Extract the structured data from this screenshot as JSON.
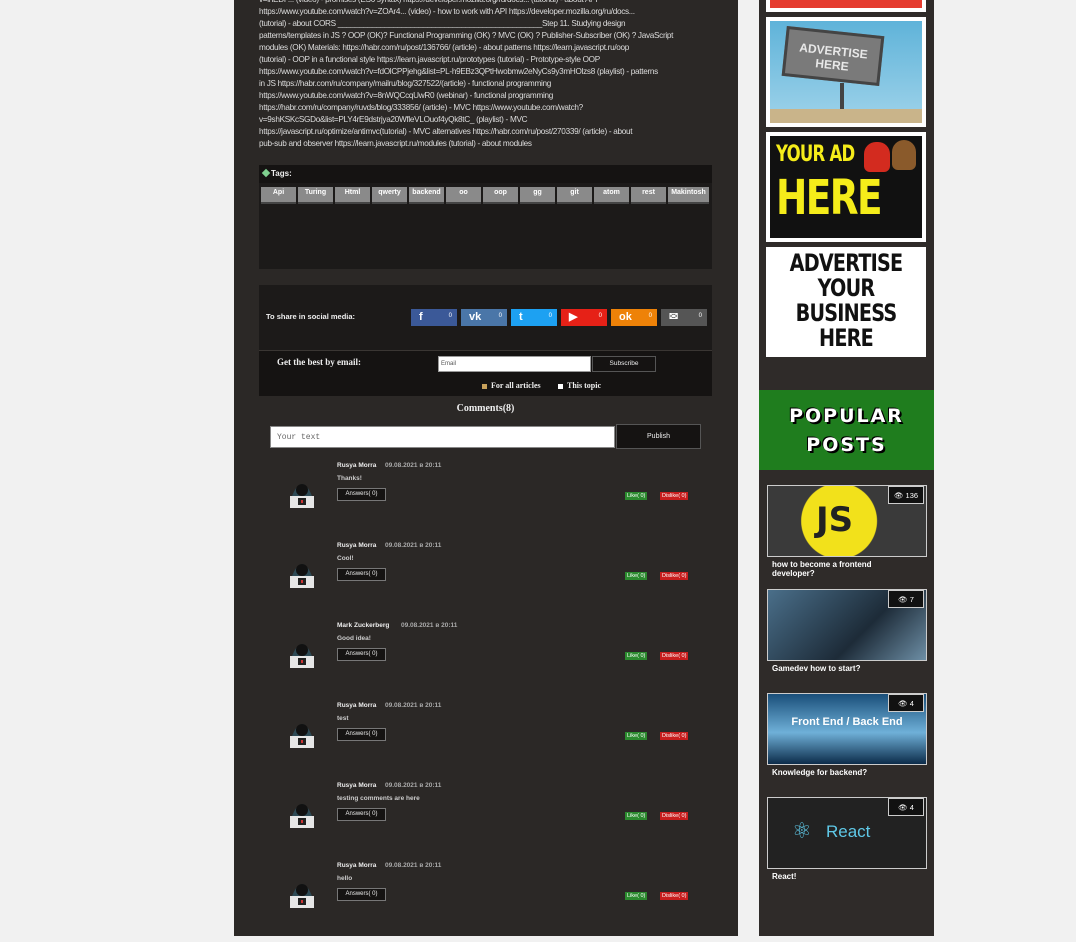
{
  "article": {
    "lines": [
      "v=lnEDP... (video) - promises (ES6 syntax) https://developer.mozilla.org/ru/docs... (tutorial) - about API",
      "https://www.youtube.com/watch?v=ZOAr4... (video) - how to work with API https://developer.mozilla.org/ru/docs...",
      "(tutorial) - about CORS ________________________________________________Step 11. Studying design",
      "patterns/templates in JS ? OOP (OK)? Functional Programming (OK) ? MVC (OK) ? Publisher-Subscriber (OK) ? JavaScript",
      "modules (OK) Materials: https://habr.com/ru/post/136766/ (article) - about patterns https://learn.javascript.ru/oop",
      "(tutorial) - OOP in a functional style https://learn.javascript.ru/prototypes (tutorial) - Prototype-style OOP",
      "https://www.youtube.com/watch?v=fdOlCPPjehg&list=PL-h9EBz3QPtHwobmw2eNyCs9y3mHOlzs8 (playlist) - patterns",
      "in JS https://habr.com/ru/company/mailru/blog/327522/(article) - functional programming",
      "https://www.youtube.com/watch?v=8nWQCcqUwR0 (webinar) - functional programming",
      "https://habr.com/ru/company/ruvds/blog/333856/ (article) - MVC https://www.youtube.com/watch?",
      "v=9shKSKcSGDo&list=PLY4rE9dstrjya20WfleVLOuof4yQk8tC_ (playlist) - MVC",
      "https://javascript.ru/optimize/antimvc(tutorial) - MVC alternatives https://habr.com/ru/post/270339/ (article) - about",
      "pub-sub and observer https://learn.javascript.ru/modules (tutorial) - about modules"
    ]
  },
  "tags": {
    "label": "Tags:",
    "items": [
      "Api",
      "Turing",
      "Html",
      "qwerty",
      "backend",
      "oo",
      "oop",
      "gg",
      "git",
      "atom",
      "rest",
      "Makintosh"
    ]
  },
  "share": {
    "label": "To share in social media:",
    "buttons": [
      {
        "name": "facebook",
        "icon": "f",
        "count": "0",
        "color": "#3b5998"
      },
      {
        "name": "vk",
        "icon": "vk",
        "count": "0",
        "color": "#4a76a8"
      },
      {
        "name": "twitter",
        "icon": "t",
        "count": "0",
        "color": "#1da1f2"
      },
      {
        "name": "youtube",
        "icon": "▶",
        "count": "0",
        "color": "#e62117"
      },
      {
        "name": "odnoklassniki",
        "icon": "ok",
        "count": "0",
        "color": "#ee8208"
      },
      {
        "name": "email",
        "icon": "✉",
        "count": "0",
        "color": "#555555"
      }
    ]
  },
  "email": {
    "label": "Get the best by email:",
    "placeholder": "Email",
    "subscribe": "Subscribe",
    "opt_all": "For all articles",
    "opt_topic": "This topic"
  },
  "comments": {
    "title": "Comments(8)",
    "placeholder": "Your text",
    "publish": "Publish",
    "items": [
      {
        "author": "Rusya Morra",
        "date": "09.08.2021 в 20:11",
        "text": "Thanks!",
        "answers": "Answers( 0)",
        "like": "Like( 0)",
        "dislike": "Dislike( 0)"
      },
      {
        "author": "Rusya Morra",
        "date": "09.08.2021 в 20:11",
        "text": "Cool!",
        "answers": "Answers( 0)",
        "like": "Like( 0)",
        "dislike": "Dislike( 0)"
      },
      {
        "author": "Mark Zuckerberg",
        "date": "09.08.2021 в 20:11",
        "text": "Good idea!",
        "answers": "Answers( 0)",
        "like": "Like( 0)",
        "dislike": "Dislike( 0)"
      },
      {
        "author": "Rusya Morra",
        "date": "09.08.2021 в 20:11",
        "text": "test",
        "answers": "Answers( 0)",
        "like": "Like( 0)",
        "dislike": "Dislike( 0)"
      },
      {
        "author": "Rusya Morra",
        "date": "09.08.2021 в 20:11",
        "text": "testing comments are here",
        "answers": "Answers( 0)",
        "like": "Like( 0)",
        "dislike": "Dislike( 0)"
      },
      {
        "author": "Rusya Morra",
        "date": "09.08.2021 в 20:11",
        "text": "hello",
        "answers": "Answers( 0)",
        "like": "Like( 0)",
        "dislike": "Dislike( 0)"
      }
    ]
  },
  "ads": {
    "billboard_text": "ADVERTISE HERE",
    "your_ad_line1": "YOUR AD",
    "your_ad_line2": "HERE",
    "business_text": "ADVERTISE YOUR BUSINESS HERE"
  },
  "popular": {
    "title_line1": "POPULAR",
    "title_line2": "POSTS",
    "posts": [
      {
        "views": "136",
        "title": "how to become a frontend developer?",
        "image_text": "JS"
      },
      {
        "views": "7",
        "title": "Gamedev how to start?",
        "image_text": ""
      },
      {
        "views": "4",
        "title": "Knowledge for backend?",
        "image_text": "Front End / Back End"
      },
      {
        "views": "4",
        "title": "React!",
        "image_text": "React"
      }
    ]
  }
}
